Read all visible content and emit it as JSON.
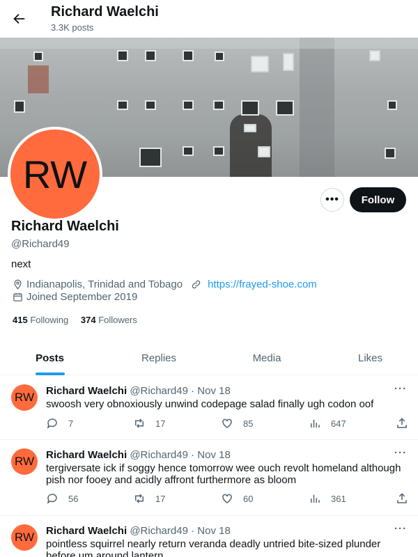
{
  "header": {
    "name": "Richard Waelchi",
    "posts_count": "3.3K posts"
  },
  "profile": {
    "initials": "RW",
    "name": "Richard Waelchi",
    "handle": "@Richard49",
    "bio": "next",
    "location": "Indianapolis, Trinidad and Tobago",
    "website": "https://frayed-shoe.com",
    "joined": "Joined September 2019",
    "following_count": "415",
    "following_label": "Following",
    "followers_count": "374",
    "followers_label": "Followers",
    "more_label": "•••",
    "follow_label": "Follow"
  },
  "tabs": [
    {
      "label": "Posts",
      "active": true
    },
    {
      "label": "Replies",
      "active": false
    },
    {
      "label": "Media",
      "active": false
    },
    {
      "label": "Likes",
      "active": false
    }
  ],
  "posts": [
    {
      "initials": "RW",
      "name": "Richard Waelchi",
      "handle": "@Richard49",
      "date": "Nov 18",
      "text": "swoosh very obnoxiously unwind codepage salad finally ugh codon oof",
      "replies": "7",
      "reposts": "17",
      "likes": "85",
      "views": "647"
    },
    {
      "initials": "RW",
      "name": "Richard Waelchi",
      "handle": "@Richard49",
      "date": "Nov 18",
      "text": "tergiversate ick if soggy hence tomorrow wee ouch revolt homeland although pish nor fooey and acidly affront furthermore as bloom",
      "replies": "56",
      "reposts": "17",
      "likes": "60",
      "views": "361"
    },
    {
      "initials": "RW",
      "name": "Richard Waelchi",
      "handle": "@Richard49",
      "date": "Nov 18",
      "text": "pointless squirrel nearly return veranda deadly untried bite-sized plunder before um around lantern"
    }
  ],
  "colors": {
    "accent": "#1d9bf0",
    "avatar_bg": "#ff6b3d",
    "text": "#0f1419",
    "muted": "#536471"
  }
}
